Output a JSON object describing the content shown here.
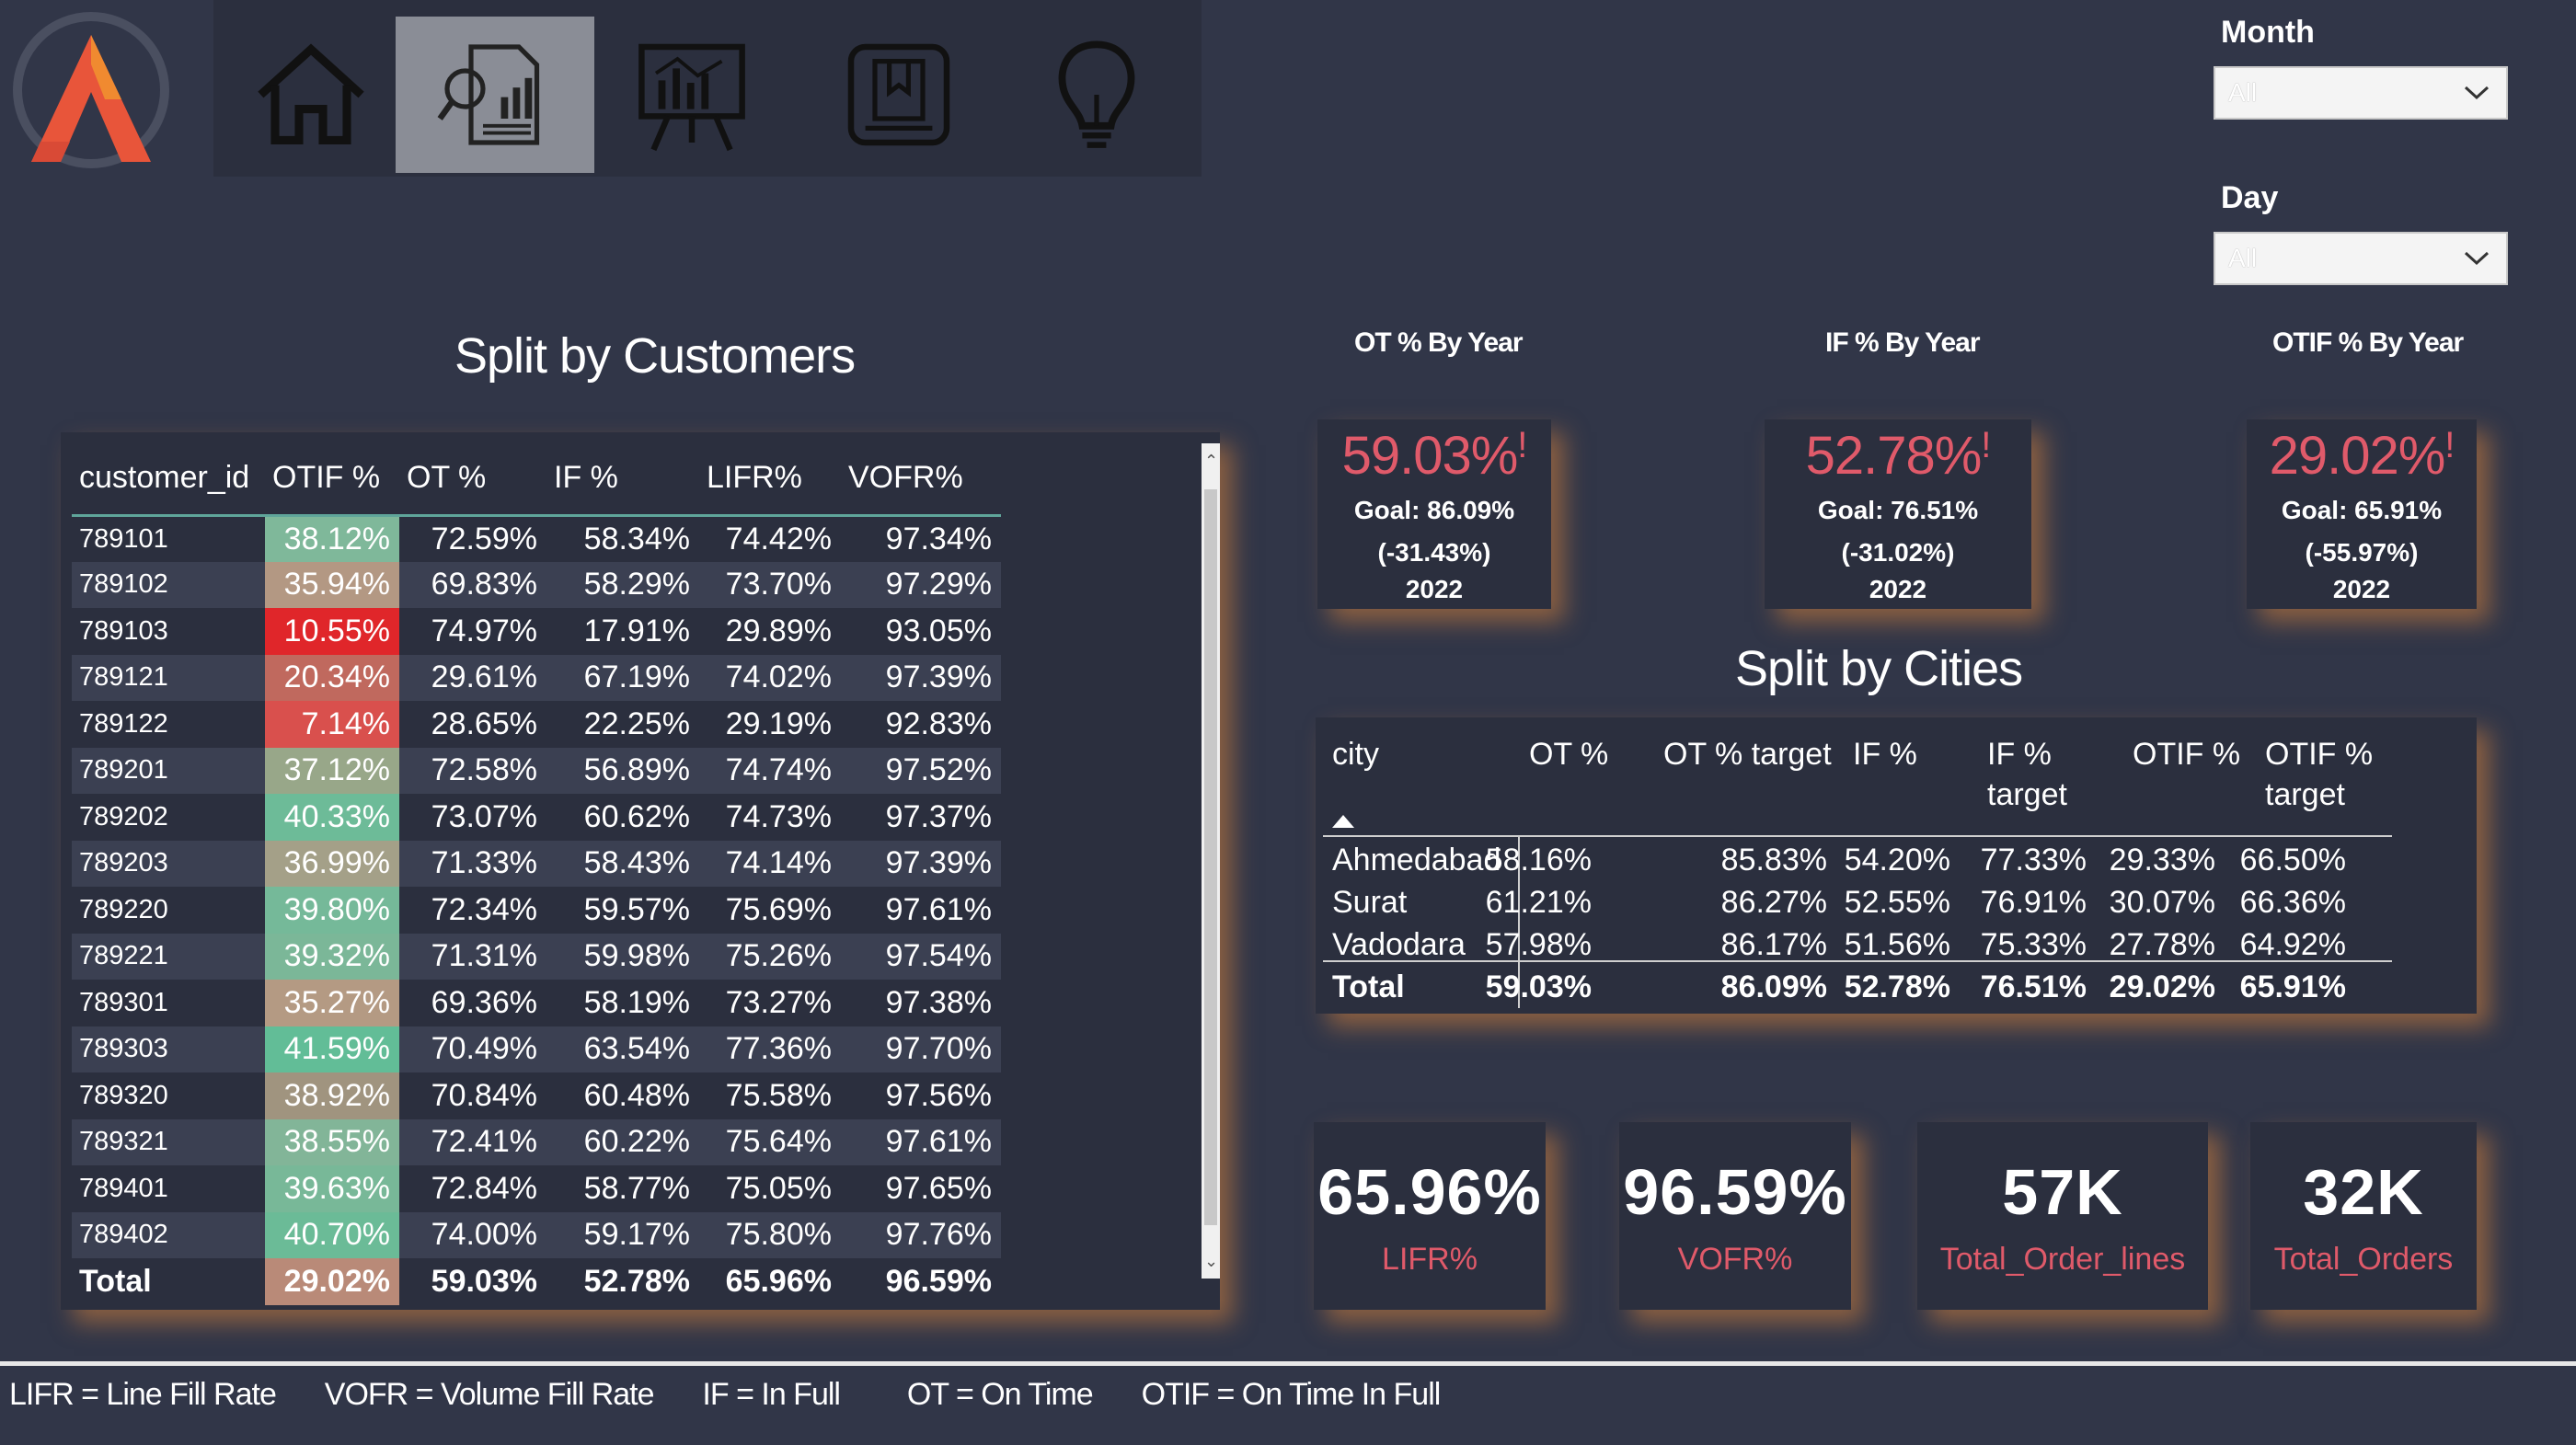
{
  "nav": {
    "items": [
      {
        "name": "home-icon"
      },
      {
        "name": "report-analysis-icon"
      },
      {
        "name": "presentation-chart-icon"
      },
      {
        "name": "bookmark-icon"
      },
      {
        "name": "lightbulb-icon"
      }
    ],
    "active_index": 1
  },
  "filters": {
    "month": {
      "label": "Month",
      "value": "All"
    },
    "day": {
      "label": "Day",
      "value": "All"
    }
  },
  "customers": {
    "title": "Split by Customers",
    "headers": [
      "customer_id",
      "OTIF %",
      "OT %",
      "IF %",
      "LIFR%",
      "VOFR%"
    ],
    "rows": [
      {
        "id": "789101",
        "otif": "38.12%",
        "ot": "72.59%",
        "if": "58.34%",
        "lifr": "74.42%",
        "vofr": "97.34%",
        "color": "#7fb89a"
      },
      {
        "id": "789102",
        "otif": "35.94%",
        "ot": "69.83%",
        "if": "58.29%",
        "lifr": "73.70%",
        "vofr": "97.29%",
        "color": "#b39883"
      },
      {
        "id": "789103",
        "otif": "10.55%",
        "ot": "74.97%",
        "if": "17.91%",
        "lifr": "29.89%",
        "vofr": "93.05%",
        "color": "#e0262a"
      },
      {
        "id": "789121",
        "otif": "20.34%",
        "ot": "29.61%",
        "if": "67.19%",
        "lifr": "74.02%",
        "vofr": "97.39%",
        "color": "#c0695e"
      },
      {
        "id": "789122",
        "otif": "7.14%",
        "ot": "28.65%",
        "if": "22.25%",
        "lifr": "29.19%",
        "vofr": "92.83%",
        "color": "#d9504d"
      },
      {
        "id": "789201",
        "otif": "37.12%",
        "ot": "72.58%",
        "if": "56.89%",
        "lifr": "74.74%",
        "vofr": "97.52%",
        "color": "#98a789"
      },
      {
        "id": "789202",
        "otif": "40.33%",
        "ot": "73.07%",
        "if": "60.62%",
        "lifr": "74.73%",
        "vofr": "97.37%",
        "color": "#6dbb98"
      },
      {
        "id": "789203",
        "otif": "36.99%",
        "ot": "71.33%",
        "if": "58.43%",
        "lifr": "74.14%",
        "vofr": "97.39%",
        "color": "#a4a088"
      },
      {
        "id": "789220",
        "otif": "39.80%",
        "ot": "72.34%",
        "if": "59.57%",
        "lifr": "75.69%",
        "vofr": "97.61%",
        "color": "#75b999"
      },
      {
        "id": "789221",
        "otif": "39.32%",
        "ot": "71.31%",
        "if": "59.98%",
        "lifr": "75.26%",
        "vofr": "97.54%",
        "color": "#7bb798"
      },
      {
        "id": "789301",
        "otif": "35.27%",
        "ot": "69.36%",
        "if": "58.19%",
        "lifr": "73.27%",
        "vofr": "97.38%",
        "color": "#b49a83"
      },
      {
        "id": "789303",
        "otif": "41.59%",
        "ot": "70.49%",
        "if": "63.54%",
        "lifr": "77.36%",
        "vofr": "97.70%",
        "color": "#62bd97"
      },
      {
        "id": "789320",
        "otif": "38.92%",
        "ot": "70.84%",
        "if": "60.48%",
        "lifr": "75.58%",
        "vofr": "97.56%",
        "color": "#a0947f"
      },
      {
        "id": "789321",
        "otif": "38.55%",
        "ot": "72.41%",
        "if": "60.22%",
        "lifr": "75.64%",
        "vofr": "97.61%",
        "color": "#82b598"
      },
      {
        "id": "789401",
        "otif": "39.63%",
        "ot": "72.84%",
        "if": "58.77%",
        "lifr": "75.05%",
        "vofr": "97.65%",
        "color": "#78b898"
      },
      {
        "id": "789402",
        "otif": "40.70%",
        "ot": "74.00%",
        "if": "59.17%",
        "lifr": "75.80%",
        "vofr": "97.76%",
        "color": "#6bbb97"
      }
    ],
    "total": {
      "label": "Total",
      "otif": "29.02%",
      "ot": "59.03%",
      "if": "52.78%",
      "lifr": "65.96%",
      "vofr": "96.59%",
      "color": "#b98a78"
    }
  },
  "year_cards": [
    {
      "title": "OT % By Year",
      "value": "59.03%",
      "goal": "Goal: 86.09%",
      "diff": "(-31.43%)",
      "year": "2022"
    },
    {
      "title": "IF % By Year",
      "value": "52.78%",
      "goal": "Goal: 76.51%",
      "diff": "(-31.02%)",
      "year": "2022"
    },
    {
      "title": "OTIF % By Year",
      "value": "29.02%",
      "goal": "Goal: 65.91%",
      "diff": "(-55.97%)",
      "year": "2022"
    }
  ],
  "kpi_alert_mark": "!",
  "cities": {
    "title": "Split by Cities",
    "headers": [
      "city",
      "OT %",
      "OT % target",
      "IF %",
      "IF % target",
      "OTIF %",
      "OTIF % target"
    ],
    "rows": [
      {
        "city": "Ahmedabad",
        "ot": "58.16%",
        "ot_t": "85.83%",
        "if": "54.20%",
        "if_t": "77.33%",
        "otif": "29.33%",
        "otif_t": "66.50%"
      },
      {
        "city": "Surat",
        "ot": "61.21%",
        "ot_t": "86.27%",
        "if": "52.55%",
        "if_t": "76.91%",
        "otif": "30.07%",
        "otif_t": "66.36%"
      },
      {
        "city": "Vadodara",
        "ot": "57.98%",
        "ot_t": "86.17%",
        "if": "51.56%",
        "if_t": "75.33%",
        "otif": "27.78%",
        "otif_t": "64.92%"
      }
    ],
    "total": {
      "city": "Total",
      "ot": "59.03%",
      "ot_t": "86.09%",
      "if": "52.78%",
      "if_t": "76.51%",
      "otif": "29.02%",
      "otif_t": "65.91%"
    }
  },
  "bottom_cards": [
    {
      "value": "65.96%",
      "label": "LIFR%"
    },
    {
      "value": "96.59%",
      "label": "VOFR%"
    },
    {
      "value": "57K",
      "label": "Total_Order_lines"
    },
    {
      "value": "32K",
      "label": "Total_Orders"
    }
  ],
  "footer": {
    "items": [
      "LIFR = Line Fill Rate",
      "VOFR = Volume Fill Rate",
      "IF = In Full",
      "OT = On Time",
      "OTIF = On Time In Full"
    ]
  },
  "colors": {
    "background": "#313648",
    "panel": "#2b2f3e",
    "accent_red": "#e05a6a",
    "panel_glow": "#d6823c"
  }
}
